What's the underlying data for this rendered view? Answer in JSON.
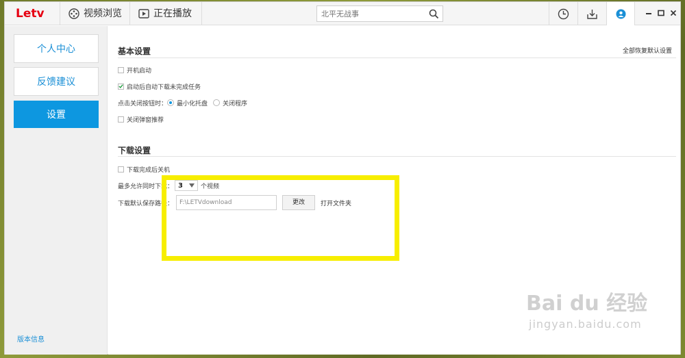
{
  "app": {
    "logo": "Letv",
    "brand_color": "#e60012",
    "accent_color": "#0d97e0"
  },
  "titlebar": {
    "tabs": [
      {
        "label": "视频浏览",
        "icon": "film-reel-icon"
      },
      {
        "label": "正在播放",
        "icon": "play-icon"
      }
    ],
    "search": {
      "placeholder": "北平无战事",
      "icon": "search-icon"
    },
    "buttons": [
      {
        "icon": "history-clock-icon"
      },
      {
        "icon": "download-icon"
      },
      {
        "icon": "user-icon"
      }
    ],
    "window_controls": [
      "minimize-icon",
      "maximize-icon",
      "close-icon"
    ]
  },
  "sidebar": {
    "items": [
      {
        "label": "个人中心"
      },
      {
        "label": "反馈建议"
      },
      {
        "label": "设置",
        "active": true
      }
    ],
    "version_link": "版本信息"
  },
  "settings": {
    "basic": {
      "title": "基本设置",
      "restore_defaults": "全部恢复默认设置",
      "autostart": {
        "label": "开机启动",
        "checked": false
      },
      "resume_downloads": {
        "label": "启动后自动下载未完成任务",
        "checked": true
      },
      "close_behavior": {
        "label": "点击关闭按钮时：",
        "options": [
          {
            "label": "最小化托盘",
            "selected": true
          },
          {
            "label": "关闭程序",
            "selected": false
          }
        ]
      },
      "disable_popup": {
        "label": "关闭弹窗推荐",
        "checked": false
      }
    },
    "download": {
      "title": "下载设置",
      "shutdown_after": {
        "label": "下载完成后关机",
        "checked": false
      },
      "max_concurrent": {
        "label": "最多允许同时下载：",
        "value": "3",
        "unit": "个视频"
      },
      "save_path": {
        "label": "下载默认保存路径：",
        "value": "F:\\LETVdownload",
        "change_label": "更改",
        "open_folder_label": "打开文件夹"
      }
    }
  },
  "watermark": {
    "line1": "Bai du 经验",
    "line2": "jingyan.baidu.com"
  }
}
